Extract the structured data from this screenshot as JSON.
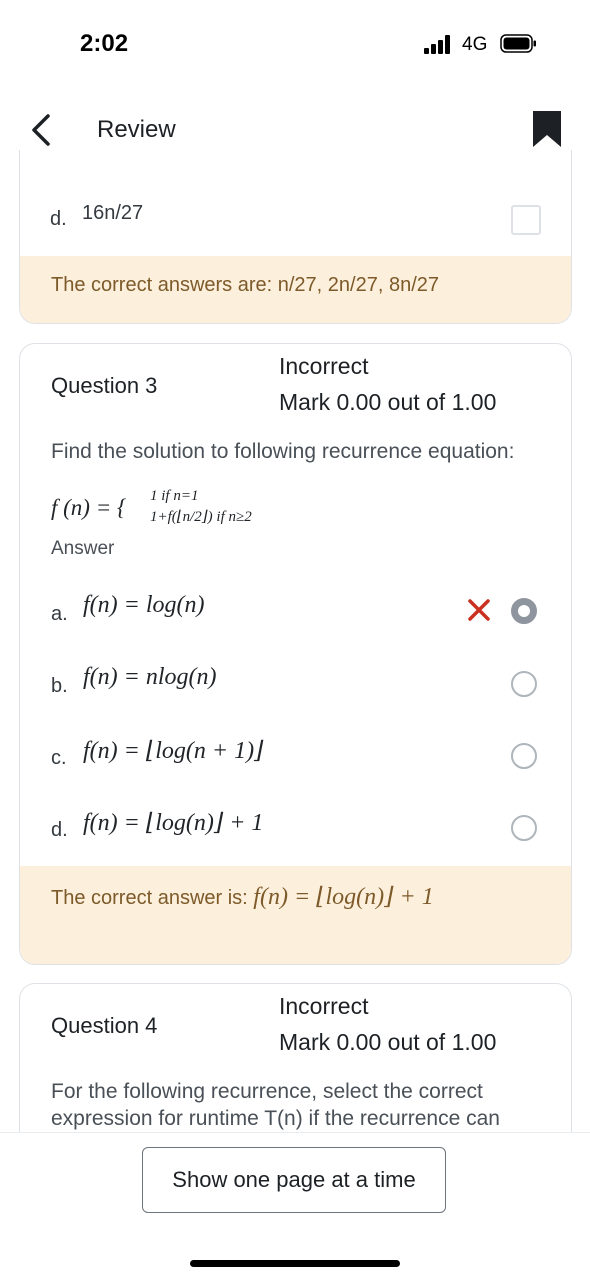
{
  "status_bar": {
    "time": "2:02",
    "network": "4G"
  },
  "header": {
    "title": "Review",
    "back_icon": "chevron-left-icon",
    "bookmark_icon": "bookmark-icon"
  },
  "q2_tail": {
    "option_d": {
      "letter": "d.",
      "text": "16n/27"
    },
    "feedback": "The correct answers are: n/27, 2n/27, 8n/27"
  },
  "question3": {
    "label": "Question 3",
    "state": "Incorrect",
    "mark": "Mark 0.00 out of 1.00",
    "text": "Find the solution to following recurrence equation:",
    "formula_lhs": "f (n) = {",
    "formula_case1": "1 if n=1",
    "formula_case2": "1+f(⌊n/2⌋) if n≥2",
    "answer_label": "Answer",
    "options": [
      {
        "letter": "a.",
        "text": "f(n) = log(n)",
        "selected": true,
        "marked_wrong": true
      },
      {
        "letter": "b.",
        "text": "f(n) = nlog(n)",
        "selected": false
      },
      {
        "letter": "c.",
        "text": "f(n) = ⌊log(n + 1)⌋",
        "selected": false
      },
      {
        "letter": "d.",
        "text": "f(n) = ⌊log(n)⌋ + 1",
        "selected": false
      }
    ],
    "feedback_prefix": "The correct answer is: ",
    "feedback_math": "f(n) = ⌊log(n)⌋ + 1"
  },
  "question4": {
    "label": "Question 4",
    "state": "Incorrect",
    "mark": "Mark 0.00 out of 1.00",
    "text_line1": "For the following recurrence, select the correct",
    "text_line2": "expression for runtime T(n) if the recurrence can"
  },
  "footer": {
    "button_label": "Show one page at a time"
  },
  "colors": {
    "feedback_bg": "#fcefdc",
    "feedback_text": "#7d5a29",
    "wrong_mark": "#ca3120"
  }
}
